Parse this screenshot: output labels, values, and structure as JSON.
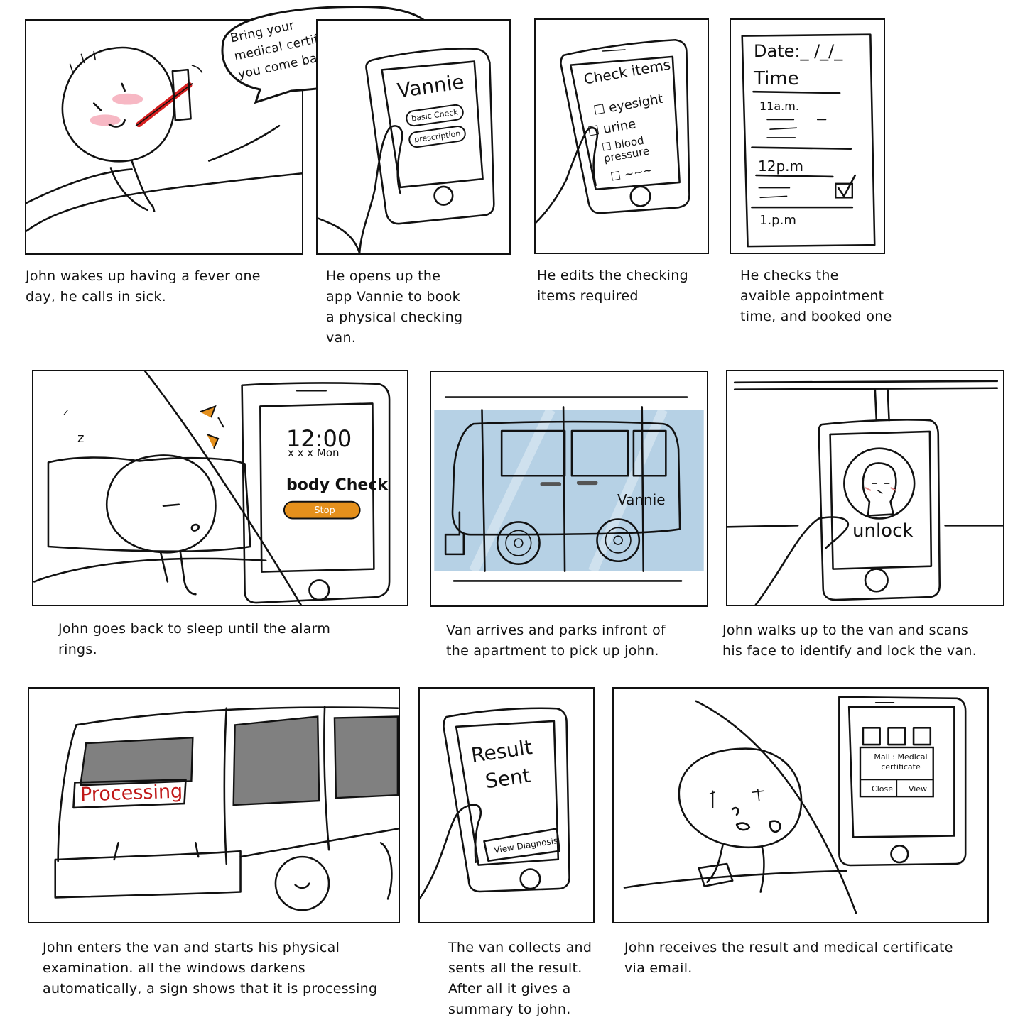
{
  "colors": {
    "ink": "#111111",
    "thermometer": "#d62020",
    "blush": "#f7b8c4",
    "alarm_button": "#e5901c",
    "window_tint": "#a9c9e0",
    "processing_text": "#c01818",
    "dark_window": "#808080"
  },
  "panels": [
    {
      "speech_bubble": "Bring your\nmedical certificate when\nyou come back",
      "caption": "John wakes up having a fever one\nday, he calls in sick."
    },
    {
      "app_name": "Vannie",
      "buttons": [
        "basic Check",
        "prescription"
      ],
      "caption": " He opens up the\napp Vannie to book\n a physical checking\nvan."
    },
    {
      "title": "Check items",
      "items": [
        "eyesight",
        "urine",
        "blood\npressure",
        "~~~"
      ],
      "caption": "He edits the checking\nitems required"
    },
    {
      "date_label": "Date:_ /_/_",
      "time_label": "Time",
      "slots": [
        "11a.m.",
        "12p.m",
        "1.p.m"
      ],
      "caption": "He checks the\navaible appointment\ntime, and booked one"
    },
    {
      "clock": "12:00",
      "day": "x x x Mon",
      "alarm_label": "body Check",
      "alarm_button": "Stop",
      "sleep": [
        "z",
        "z"
      ],
      "caption": "John goes back to sleep until the alarm\nrings."
    },
    {
      "van_label": "Vannie",
      "caption": "Van arrives and parks infront of\nthe apartment to pick up  john."
    },
    {
      "phone_text": "unlock",
      "caption": "John walks up to the van and scans\nhis face to identify and lock the van."
    },
    {
      "sign": "Processing",
      "caption": "John enters the van and starts his physical\nexamination. all the windows darkens\nautomatically, a sign shows that it is  processing"
    },
    {
      "result_line1": "Result",
      "result_line2": "Sent",
      "button": "View Diagnosis",
      "caption": "The van collects and\nsents all the result.\nAfter all it gives a\nsummary to john."
    },
    {
      "notification": "Mail : Medical\ncertificate",
      "buttons": [
        "Close",
        "View"
      ],
      "caption": "John receives the result and medical certificate\nvia email."
    }
  ]
}
